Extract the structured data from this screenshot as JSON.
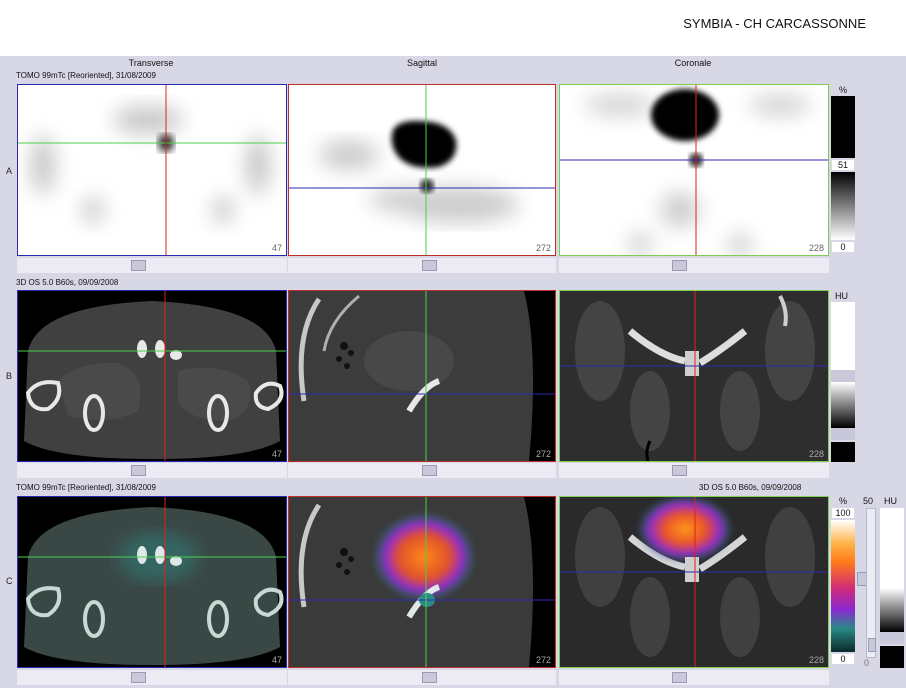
{
  "header": {
    "title": "SYMBIA - CH CARCASSONNE"
  },
  "columns": [
    "Transverse",
    "Sagittal",
    "Coronale"
  ],
  "rows": [
    {
      "label": "A",
      "series": "TOMO 99mTc [Reoriented], 31/08/2009"
    },
    {
      "label": "B",
      "series": "3D  OS  5.0  B60s, 09/09/2008"
    },
    {
      "label": "C",
      "series": "TOMO 99mTc [Reoriented], 31/08/2009",
      "series_right": "3D  OS  5.0  B60s, 09/09/2008"
    }
  ],
  "slices": [
    "47",
    "272",
    "228"
  ],
  "scales": {
    "a": {
      "unit": "%",
      "mid": "51",
      "low": "0"
    },
    "b": {
      "unit": "HU"
    },
    "c": {
      "unit_pct": "%",
      "top": "100",
      "low": "0",
      "window": "50",
      "unit_hu": "HU",
      "hu_low": "0"
    }
  },
  "colors": {
    "background": "#d7d7e6",
    "transverse_frame": "#2a2ab0",
    "sagittal_frame": "#c0302a",
    "coronal_frame": "#7ed04a"
  }
}
